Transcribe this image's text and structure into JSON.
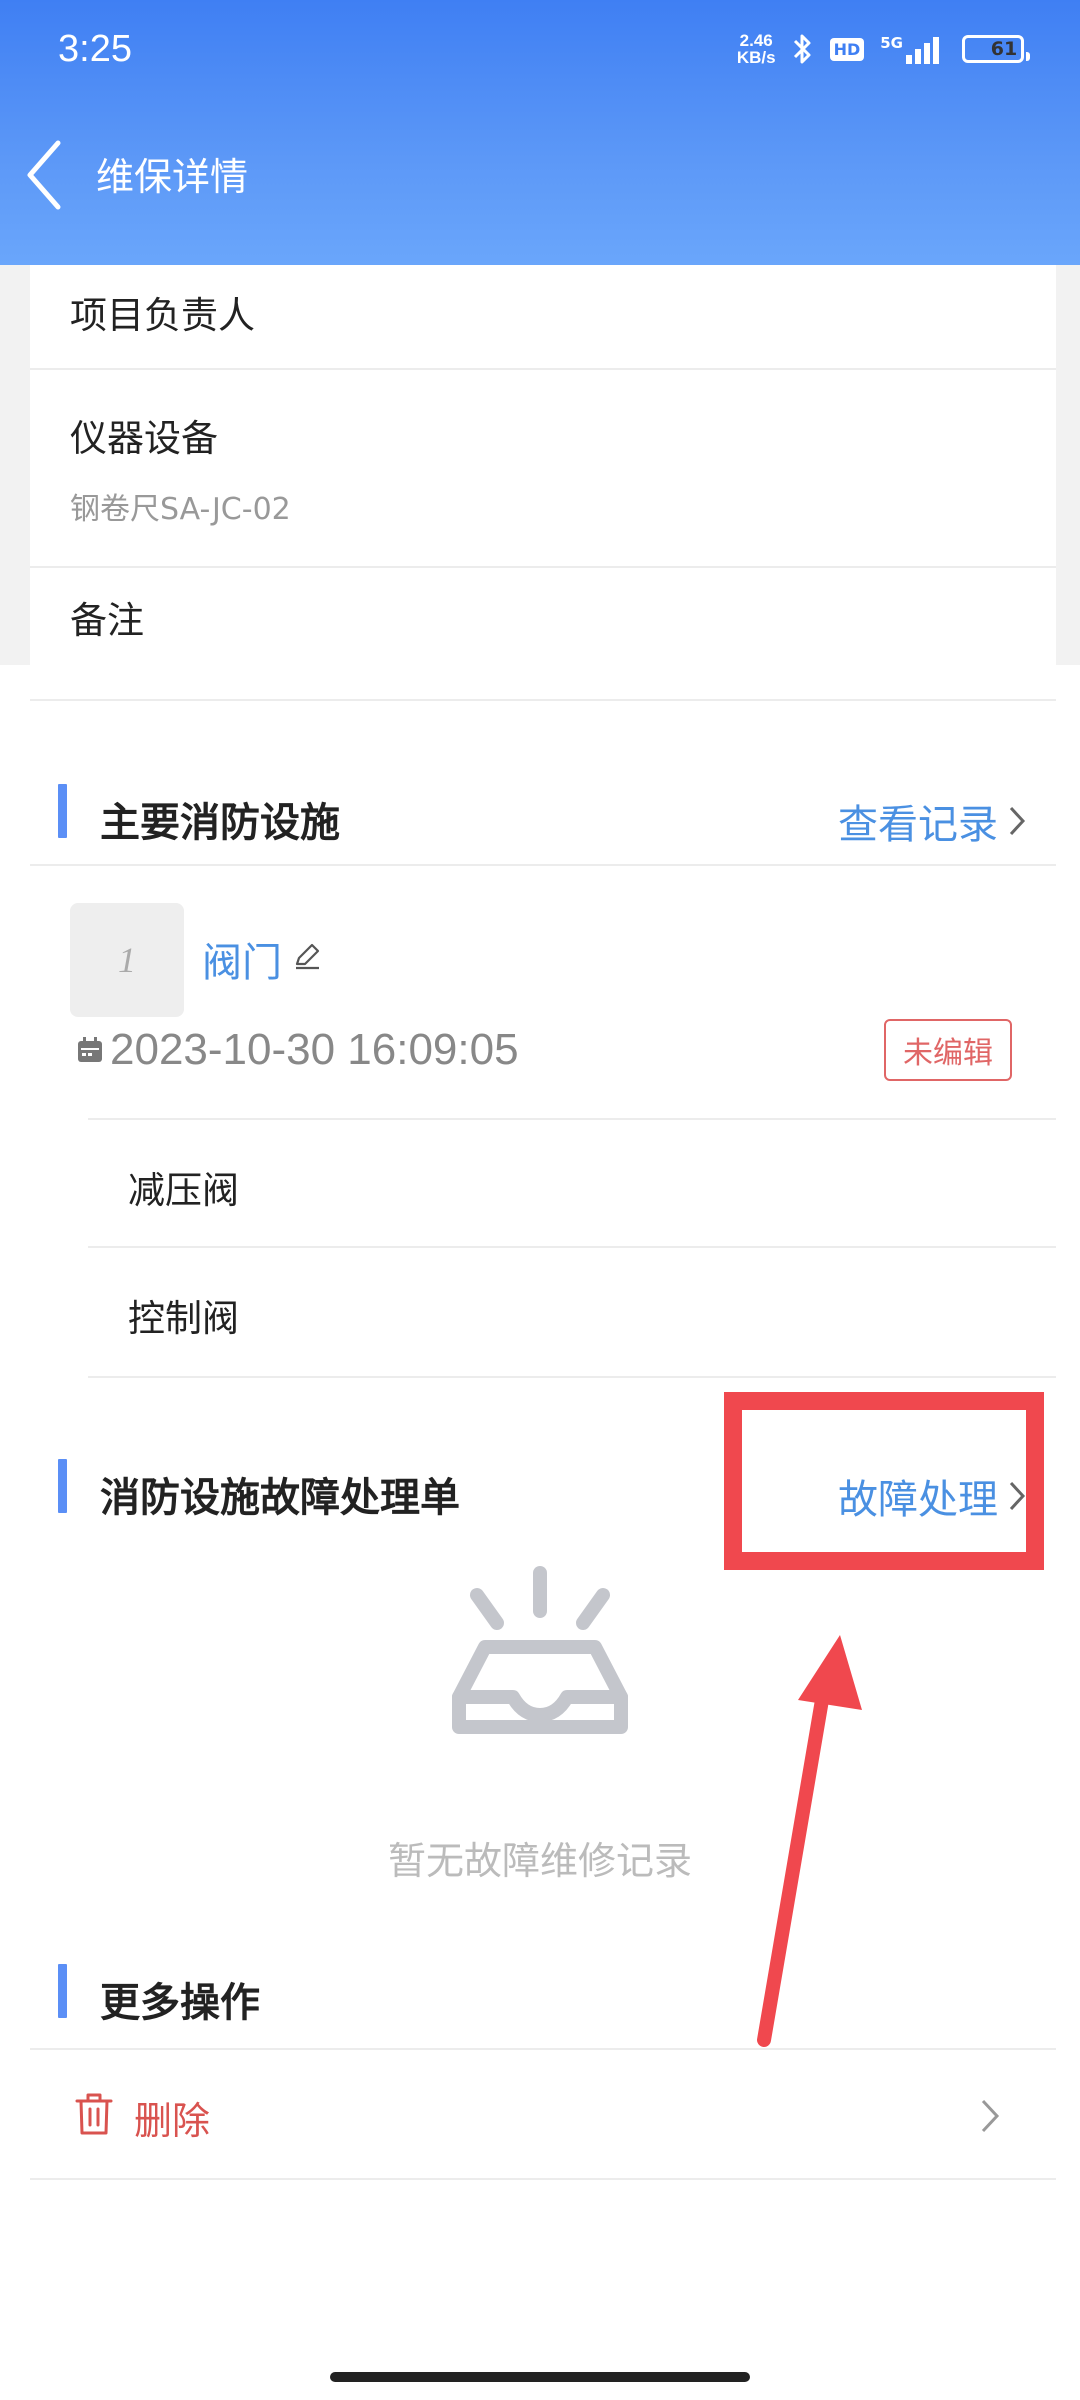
{
  "status_bar": {
    "time": "3:25",
    "net_speed_value": "2.46",
    "net_speed_unit": "KB/s",
    "hd_label": "HD",
    "network_label": "5G",
    "battery": "61"
  },
  "header": {
    "title": "维保详情"
  },
  "details": {
    "project_leader_label": "项目负责人",
    "instrument_label": "仪器设备",
    "instrument_value": "钢卷尺SA-JC-02",
    "remark_label": "备注"
  },
  "main_facilities": {
    "title": "主要消防设施",
    "link_label": "查看记录",
    "item": {
      "thumb_text": "1",
      "name": "阀门",
      "timestamp": "2023-10-30 16:09:05",
      "status": "未编辑"
    },
    "sub_items": [
      "减压阀",
      "控制阀"
    ]
  },
  "fault_section": {
    "title": "消防设施故障处理单",
    "link_label": "故障处理",
    "empty_text": "暂无故障维修记录"
  },
  "more_actions": {
    "title": "更多操作",
    "delete_label": "删除"
  },
  "colors": {
    "header_blue": "#3f7ff3",
    "link_blue": "#4a90e2",
    "danger_red": "#d9534f",
    "highlight_red": "#f0484e",
    "section_bar": "#5b8ff6"
  }
}
